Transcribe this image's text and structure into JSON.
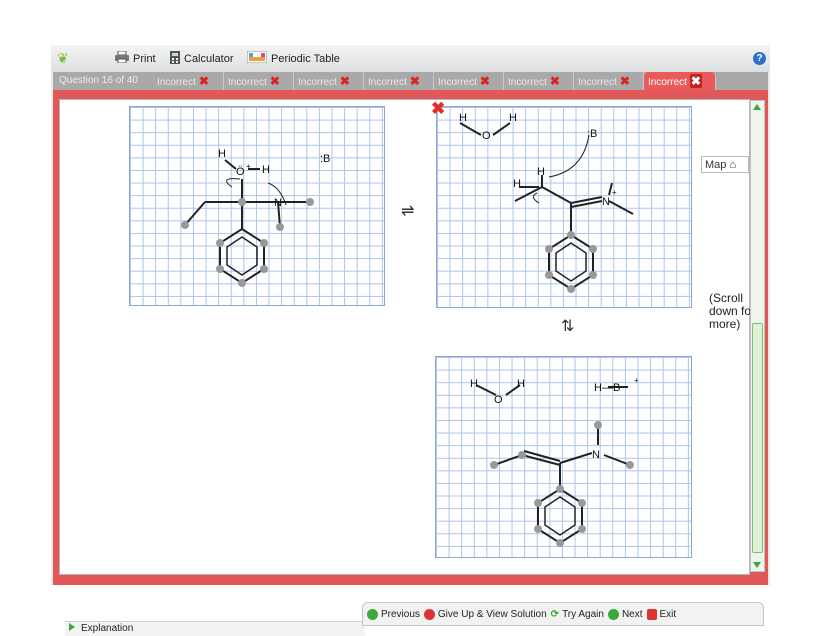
{
  "toolbar": {
    "print_label": "Print",
    "calculator_label": "Calculator",
    "periodic_label": "Periodic Table",
    "help_label": "?"
  },
  "tabs": {
    "question_label": "Question 16 of 40",
    "items": [
      "Incorrect",
      "Incorrect",
      "Incorrect",
      "Incorrect",
      "Incorrect",
      "Incorrect",
      "Incorrect",
      "Incorrect"
    ],
    "mark": "✖"
  },
  "content": {
    "map_label": "Map",
    "scroll_note": "(Scroll down for more)",
    "equilibrium": "⇌",
    "equilibrium_down": "⇅",
    "molecules": {
      "panel1": {
        "oh_label": "Ö",
        "plus": "+",
        "h": "H",
        "n_label": "N",
        "base": ":B"
      },
      "panel2": {
        "h": "H",
        "o": "O",
        "n_label": "N",
        "plus": "+",
        "base": ":B"
      },
      "panel3": {
        "h": "H",
        "o": "O",
        "n_label": "N",
        "hb": "H—B",
        "plus": "+"
      }
    }
  },
  "bottom": {
    "explanation_label": "Explanation",
    "previous_label": "Previous",
    "giveup_label": "Give Up & View Solution",
    "tryagain_label": "Try Again",
    "next_label": "Next",
    "exit_label": "Exit"
  },
  "colors": {
    "tab_active": "#ea5a5a",
    "frame": "#e25757",
    "grid": "#a9c4ea",
    "accent_green": "#3aa83a"
  }
}
